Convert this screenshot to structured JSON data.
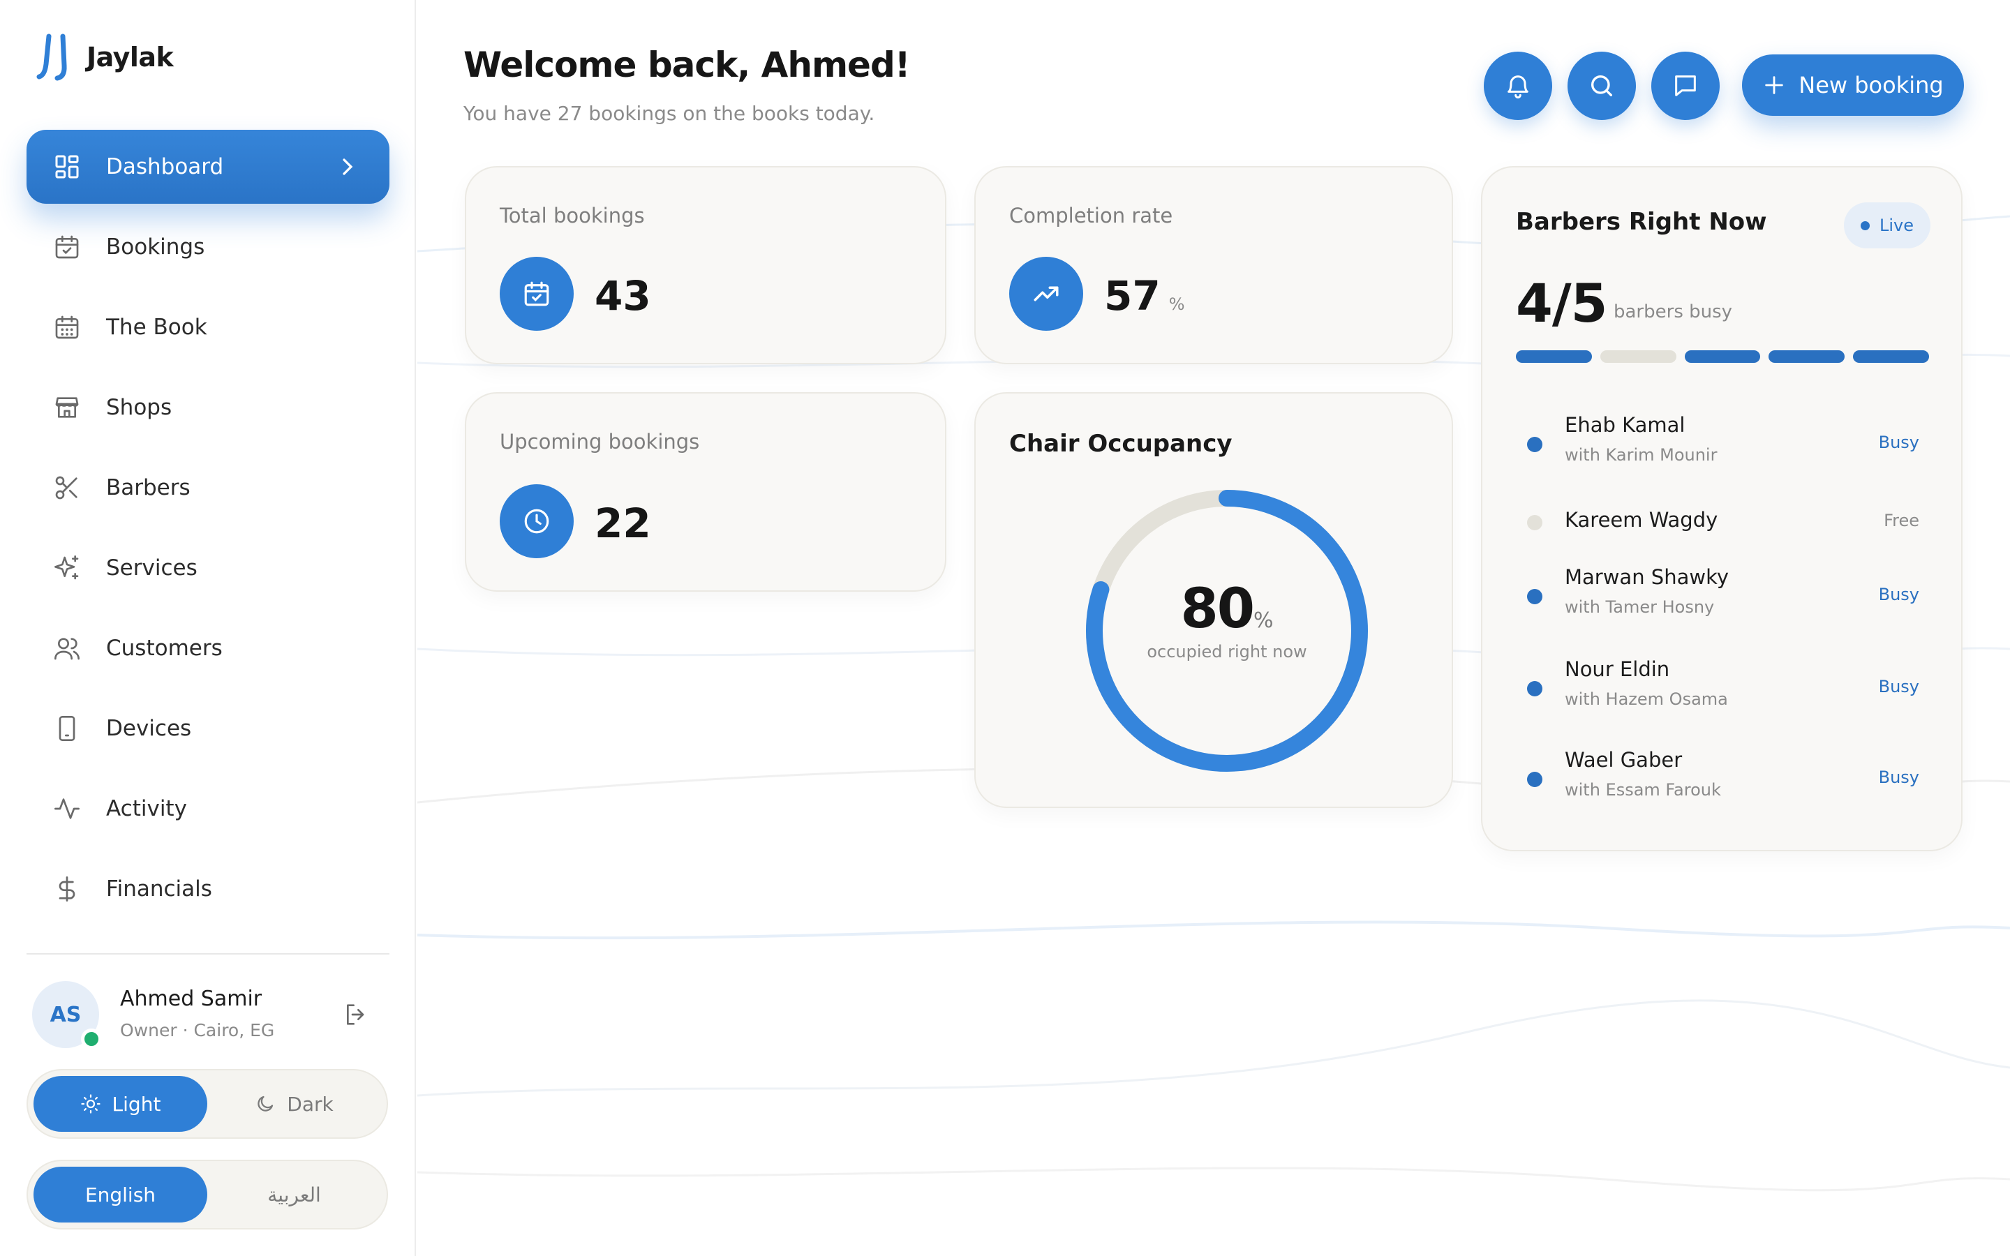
{
  "app": {
    "name": "Jaylak"
  },
  "sidebar": {
    "items": [
      {
        "label": "Dashboard",
        "icon": "dashboard-icon",
        "active": true
      },
      {
        "label": "Bookings",
        "icon": "calendar-check-icon"
      },
      {
        "label": "The Book",
        "icon": "calendar-grid-icon"
      },
      {
        "label": "Shops",
        "icon": "store-icon"
      },
      {
        "label": "Barbers",
        "icon": "scissors-icon"
      },
      {
        "label": "Services",
        "icon": "sparkles-icon"
      },
      {
        "label": "Customers",
        "icon": "users-icon"
      },
      {
        "label": "Devices",
        "icon": "tablet-icon"
      },
      {
        "label": "Activity",
        "icon": "activity-icon"
      },
      {
        "label": "Financials",
        "icon": "dollar-icon"
      }
    ],
    "user": {
      "initials": "AS",
      "name": "Ahmed Samir",
      "role": "Owner · Cairo, EG"
    },
    "theme": {
      "light": "Light",
      "dark": "Dark",
      "selected": "Light"
    },
    "language": {
      "english": "English",
      "arabic": "العربية",
      "selected": "English"
    }
  },
  "header": {
    "title": "Welcome back, Ahmed!",
    "subtitle": "You have 27 bookings on the books today.",
    "new_booking": "New booking"
  },
  "stats": {
    "total": {
      "label": "Total bookings",
      "value": "43"
    },
    "completion": {
      "label": "Completion rate",
      "value": "57",
      "unit": "%"
    },
    "upcoming": {
      "label": "Upcoming bookings",
      "value": "22"
    }
  },
  "occupancy": {
    "title": "Chair Occupancy",
    "value": "80",
    "unit": "%",
    "fraction": 0.8,
    "caption": "occupied right now"
  },
  "barbers_now": {
    "title": "Barbers Right Now",
    "live": "Live",
    "summary": "4/5",
    "summary_caption": "barbers busy",
    "segments": [
      true,
      false,
      true,
      true,
      true
    ],
    "list": [
      {
        "name": "Ehab Kamal",
        "with": "with Karim Mounir",
        "status": "Busy"
      },
      {
        "name": "Kareem Wagdy",
        "with": "",
        "status": "Free"
      },
      {
        "name": "Marwan Shawky",
        "with": "with Tamer Hosny",
        "status": "Busy"
      },
      {
        "name": "Nour Eldin",
        "with": "with Hazem Osama",
        "status": "Busy"
      },
      {
        "name": "Wael Gaber",
        "with": "with Essam Farouk",
        "status": "Busy"
      }
    ]
  },
  "colors": {
    "accent": "#2f7fd6",
    "online": "#1fae6f",
    "track": "#e3e1d9"
  }
}
